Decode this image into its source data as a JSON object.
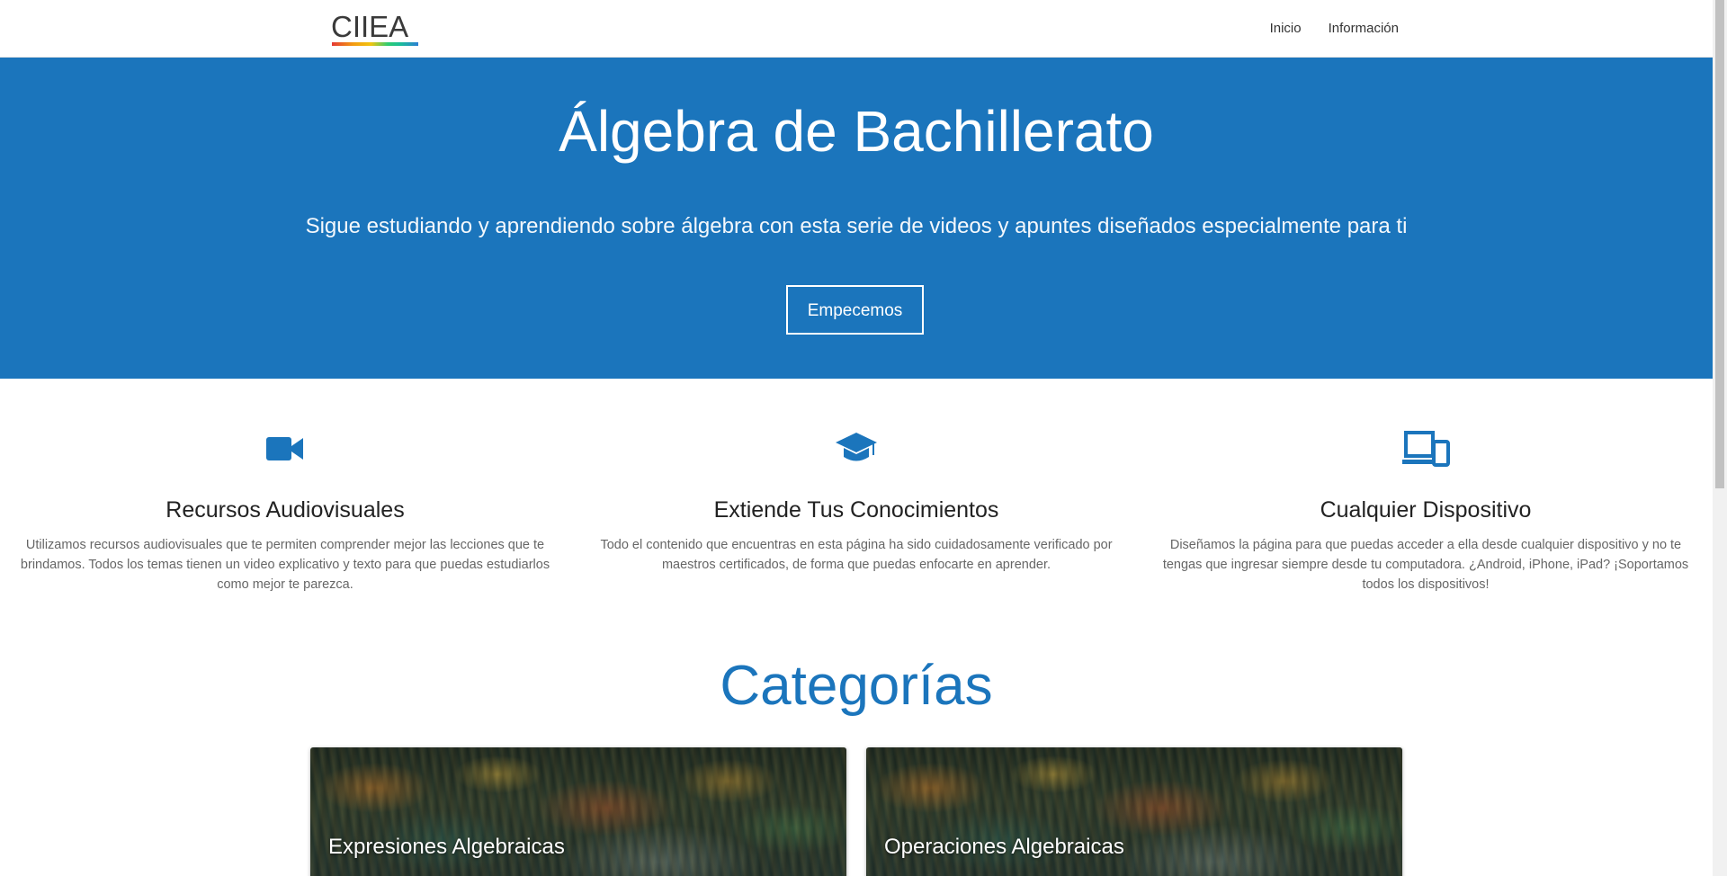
{
  "nav": {
    "logo_text": "CIIEA",
    "links": [
      "Inicio",
      "Información"
    ]
  },
  "hero": {
    "title": "Álgebra de Bachillerato",
    "subtitle": "Sigue estudiando y aprendiendo sobre álgebra con esta serie de videos y apuntes diseñados especialmente para ti",
    "button_label": "Empecemos",
    "background_color": "#1b75bc"
  },
  "features": [
    {
      "icon": "video-camera-icon",
      "title": "Recursos Audiovisuales",
      "text": "Utilizamos recursos audiovisuales que te permiten comprender mejor las lecciones que te brindamos. Todos los temas tienen un video explicativo y texto para que puedas estudiarlos como mejor te parezca."
    },
    {
      "icon": "graduation-cap-icon",
      "title": "Extiende Tus Conocimientos",
      "text": "Todo el contenido que encuentras en esta página ha sido cuidadosamente verificado por maestros certificados, de forma que puedas enfocarte en aprender."
    },
    {
      "icon": "devices-icon",
      "title": "Cualquier Dispositivo",
      "text": "Diseñamos la página para que puedas acceder a ella desde cualquier dispositivo y no te tengas que ingresar siempre desde tu computadora. ¿Android, iPhone, iPad? ¡Soportamos todos los dispositivos!"
    }
  ],
  "categories": {
    "title": "Categorías",
    "cards": [
      "Expresiones Algebraicas",
      "Operaciones Algebraicas"
    ]
  },
  "colors": {
    "accent": "#1b75bc",
    "icon": "#1b75bc"
  }
}
